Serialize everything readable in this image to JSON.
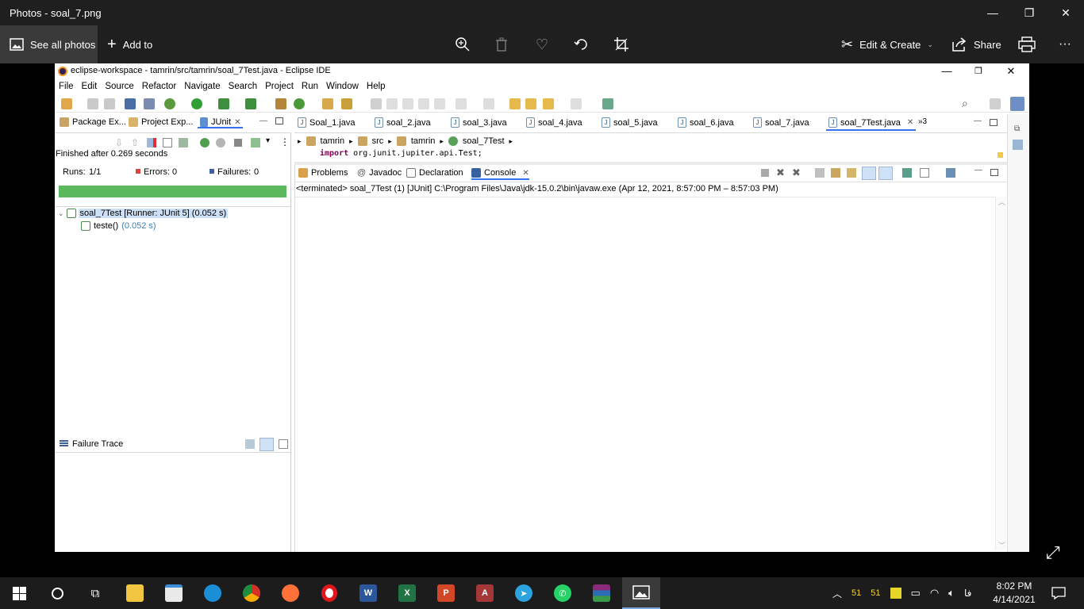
{
  "photos": {
    "title": "Photos - soal_7.png",
    "see_all": "See all photos",
    "add_to": "Add to",
    "edit_create": "Edit & Create",
    "share": "Share",
    "more": "···"
  },
  "eclipse": {
    "title": "eclipse-workspace - tamrin/src/tamrin/soal_7Test.java - Eclipse IDE",
    "menu": [
      "File",
      "Edit",
      "Source",
      "Refactor",
      "Navigate",
      "Search",
      "Project",
      "Run",
      "Window",
      "Help"
    ],
    "left_tabs": [
      "Package Ex...",
      "Project Exp...",
      "JUnit"
    ],
    "finished": "Finished after 0.269 seconds",
    "runs_label": "Runs:",
    "runs_value": "1/1",
    "errors_label": "Errors:",
    "errors_value": "0",
    "failures_label": "Failures:",
    "failures_value": "0",
    "progress": 1.0,
    "test_root": "soal_7Test [Runner: JUnit 5] (0.052 s)",
    "test_child": "teste()",
    "test_child_time": "(0.052 s)",
    "failure_trace": "Failure Trace",
    "editor_tabs": [
      "Soal_1.java",
      "soal_2.java",
      "soal_3.java",
      "soal_4.java",
      "soal_5.java",
      "soal_6.java",
      "soal_7.java",
      "soal_7Test.java"
    ],
    "editor_more": "»3",
    "breadcrumb": [
      "tamrin",
      "src",
      "tamrin",
      "soal_7Test"
    ],
    "code_keyword": "import",
    "code_rest": "org.junit.jupiter.api.Test;",
    "bottom_tabs": [
      "Problems",
      "Javadoc",
      "Declaration",
      "Console"
    ],
    "console_line": "<terminated> soal_7Test (1) [JUnit] C:\\Program Files\\Java\\jdk-15.0.2\\bin\\javaw.exe  (Apr 12, 2021, 8:57:00 PM – 8:57:03 PM)"
  },
  "taskbar": {
    "tray_a": "51",
    "tray_b": "51",
    "lang": "فا",
    "time": "8:02 PM",
    "date": "4/14/2021"
  },
  "colors": {
    "progress_green": "#5cb85c",
    "titlebar_dark": "#1f1f1f",
    "taskbar": "#1c1c1c"
  }
}
